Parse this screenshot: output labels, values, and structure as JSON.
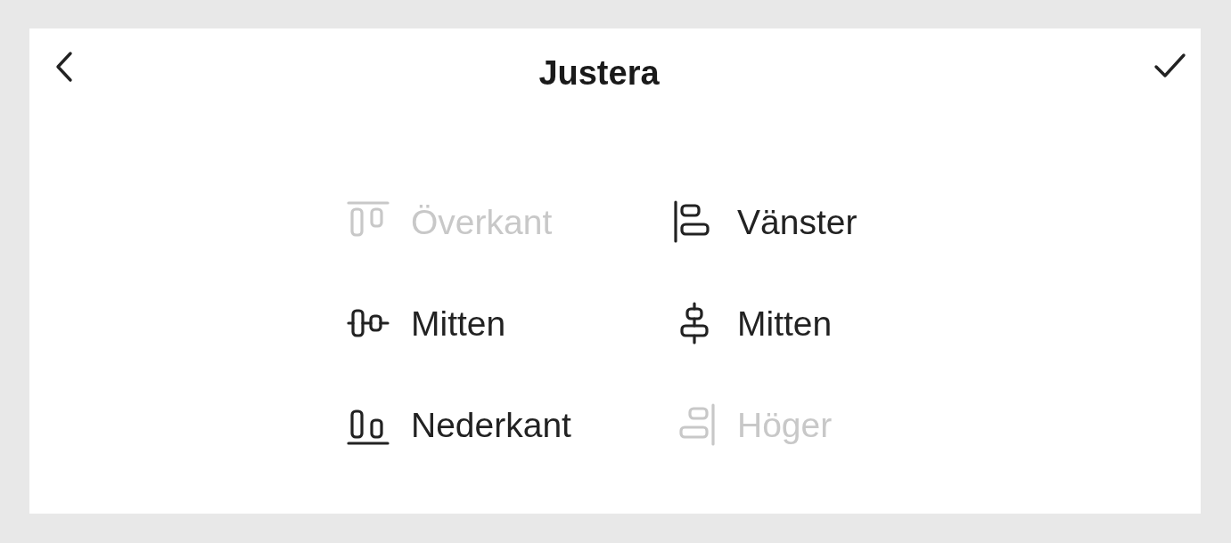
{
  "header": {
    "title": "Justera"
  },
  "options": [
    {
      "kind": "align-top",
      "label": "Överkant",
      "disabled": true
    },
    {
      "kind": "align-left",
      "label": "Vänster",
      "disabled": false
    },
    {
      "kind": "align-middle",
      "label": "Mitten",
      "disabled": false
    },
    {
      "kind": "align-center",
      "label": "Mitten",
      "disabled": false
    },
    {
      "kind": "align-bottom",
      "label": "Nederkant",
      "disabled": false
    },
    {
      "kind": "align-right",
      "label": "Höger",
      "disabled": true
    }
  ]
}
